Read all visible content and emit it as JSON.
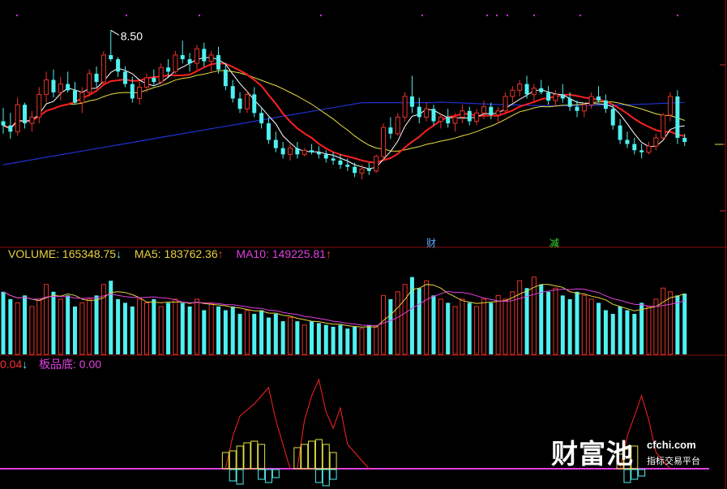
{
  "colors": {
    "background": "#000000",
    "up": "#e8342a",
    "down": "#50f0f0",
    "ma_fast": "#ffffff",
    "ma_red": "#ff2020",
    "ma_yellow": "#e8e040",
    "ma_blue": "#2030d0",
    "vol_label": "#e8d040",
    "ma5_label": "#e8d040",
    "ma10_label": "#e040e0",
    "grid": "#8a1010",
    "event_cai": "#5ab0ff",
    "event_jian": "#30e030"
  },
  "price_panel": {
    "high_label": "8.50"
  },
  "volume_panel": {
    "label_volume": "VOLUME: 165348.75",
    "arrow_volume": "↓",
    "label_ma5": "MA5: 183762.36",
    "arrow_ma5": "↑",
    "label_ma10": "MA10: 149225.81",
    "arrow_ma10": "↑"
  },
  "indicator_panel": {
    "value_label": "0.04",
    "arrow": "↓",
    "name_label": "板品底: 0.00"
  },
  "events": {
    "cai": "财",
    "jian": "减"
  },
  "watermark": {
    "chinese": "财富池",
    "domain": "cfchi.com",
    "subtitle": "指标交易平台"
  },
  "chart_data": {
    "type": "candlestick",
    "title": "",
    "ohlc": [
      [
        7.62,
        7.75,
        7.5,
        7.58
      ],
      [
        7.58,
        7.7,
        7.45,
        7.52
      ],
      [
        7.52,
        7.85,
        7.48,
        7.78
      ],
      [
        7.78,
        7.8,
        7.55,
        7.6
      ],
      [
        7.6,
        7.72,
        7.52,
        7.66
      ],
      [
        7.66,
        7.95,
        7.6,
        7.88
      ],
      [
        7.88,
        8.1,
        7.8,
        8.02
      ],
      [
        8.02,
        8.12,
        7.85,
        7.9
      ],
      [
        7.9,
        8.05,
        7.82,
        7.98
      ],
      [
        7.98,
        8.1,
        7.9,
        7.92
      ],
      [
        7.92,
        8.0,
        7.78,
        7.8
      ],
      [
        7.8,
        7.95,
        7.7,
        7.9
      ],
      [
        7.9,
        8.12,
        7.86,
        8.08
      ],
      [
        8.08,
        8.15,
        7.95,
        8.0
      ],
      [
        8.0,
        8.3,
        7.98,
        8.26
      ],
      [
        8.26,
        8.5,
        8.2,
        8.22
      ],
      [
        8.22,
        8.24,
        8.05,
        8.1
      ],
      [
        8.1,
        8.15,
        7.95,
        7.98
      ],
      [
        7.98,
        8.05,
        7.8,
        7.84
      ],
      [
        7.84,
        8.0,
        7.78,
        7.95
      ],
      [
        7.95,
        8.08,
        7.9,
        8.04
      ],
      [
        8.04,
        8.12,
        7.96,
        8.0
      ],
      [
        8.0,
        8.18,
        7.98,
        8.14
      ],
      [
        8.14,
        8.22,
        8.05,
        8.1
      ],
      [
        8.1,
        8.3,
        8.08,
        8.26
      ],
      [
        8.26,
        8.4,
        8.18,
        8.22
      ],
      [
        8.22,
        8.28,
        8.1,
        8.18
      ],
      [
        8.18,
        8.36,
        8.12,
        8.32
      ],
      [
        8.32,
        8.38,
        8.15,
        8.2
      ],
      [
        8.2,
        8.3,
        8.1,
        8.26
      ],
      [
        8.26,
        8.34,
        8.08,
        8.12
      ],
      [
        8.12,
        8.18,
        7.92,
        7.96
      ],
      [
        7.96,
        8.02,
        7.8,
        7.84
      ],
      [
        7.84,
        7.9,
        7.7,
        7.74
      ],
      [
        7.74,
        7.92,
        7.7,
        7.88
      ],
      [
        7.88,
        7.95,
        7.66,
        7.7
      ],
      [
        7.7,
        7.76,
        7.55,
        7.6
      ],
      [
        7.6,
        7.66,
        7.4,
        7.44
      ],
      [
        7.44,
        7.52,
        7.32,
        7.36
      ],
      [
        7.36,
        7.42,
        7.26,
        7.3
      ],
      [
        7.3,
        7.4,
        7.24,
        7.36
      ],
      [
        7.36,
        7.42,
        7.26,
        7.3
      ],
      [
        7.3,
        7.36,
        7.28,
        7.34
      ],
      [
        7.34,
        7.4,
        7.3,
        7.32
      ],
      [
        7.32,
        7.38,
        7.26,
        7.3
      ],
      [
        7.3,
        7.34,
        7.22,
        7.26
      ],
      [
        7.26,
        7.32,
        7.2,
        7.24
      ],
      [
        7.24,
        7.3,
        7.16,
        7.2
      ],
      [
        7.2,
        7.26,
        7.14,
        7.18
      ],
      [
        7.18,
        7.22,
        7.08,
        7.12
      ],
      [
        7.12,
        7.2,
        7.06,
        7.16
      ],
      [
        7.16,
        7.22,
        7.1,
        7.14
      ],
      [
        7.14,
        7.3,
        7.12,
        7.28
      ],
      [
        7.28,
        7.6,
        7.24,
        7.56
      ],
      [
        7.56,
        7.66,
        7.45,
        7.5
      ],
      [
        7.5,
        7.7,
        7.48,
        7.66
      ],
      [
        7.66,
        7.9,
        7.62,
        7.86
      ],
      [
        7.86,
        8.06,
        7.7,
        7.76
      ],
      [
        7.76,
        7.85,
        7.6,
        7.66
      ],
      [
        7.66,
        7.8,
        7.62,
        7.74
      ],
      [
        7.74,
        7.78,
        7.58,
        7.62
      ],
      [
        7.62,
        7.7,
        7.55,
        7.66
      ],
      [
        7.66,
        7.74,
        7.56,
        7.6
      ],
      [
        7.6,
        7.7,
        7.52,
        7.66
      ],
      [
        7.66,
        7.78,
        7.6,
        7.72
      ],
      [
        7.72,
        7.76,
        7.58,
        7.62
      ],
      [
        7.62,
        7.74,
        7.58,
        7.7
      ],
      [
        7.7,
        7.82,
        7.64,
        7.76
      ],
      [
        7.76,
        7.8,
        7.64,
        7.68
      ],
      [
        7.68,
        7.76,
        7.6,
        7.72
      ],
      [
        7.72,
        7.9,
        7.7,
        7.86
      ],
      [
        7.86,
        7.96,
        7.8,
        7.92
      ],
      [
        7.92,
        8.02,
        7.86,
        7.98
      ],
      [
        7.98,
        8.06,
        7.84,
        7.88
      ],
      [
        7.88,
        7.98,
        7.8,
        7.94
      ],
      [
        7.94,
        8.02,
        7.88,
        7.9
      ],
      [
        7.9,
        7.96,
        7.78,
        7.82
      ],
      [
        7.82,
        7.92,
        7.76,
        7.88
      ],
      [
        7.88,
        7.98,
        7.8,
        7.84
      ],
      [
        7.84,
        7.9,
        7.72,
        7.76
      ],
      [
        7.76,
        7.82,
        7.66,
        7.72
      ],
      [
        7.72,
        7.8,
        7.66,
        7.78
      ],
      [
        7.78,
        7.9,
        7.74,
        7.86
      ],
      [
        7.86,
        7.96,
        7.8,
        7.82
      ],
      [
        7.82,
        7.88,
        7.7,
        7.74
      ],
      [
        7.74,
        7.78,
        7.54,
        7.58
      ],
      [
        7.58,
        7.64,
        7.4,
        7.44
      ],
      [
        7.44,
        7.52,
        7.36,
        7.4
      ],
      [
        7.4,
        7.46,
        7.3,
        7.34
      ],
      [
        7.34,
        7.4,
        7.26,
        7.32
      ],
      [
        7.32,
        7.42,
        7.3,
        7.38
      ],
      [
        7.38,
        7.5,
        7.34,
        7.46
      ],
      [
        7.46,
        7.7,
        7.44,
        7.68
      ],
      [
        7.68,
        7.9,
        7.62,
        7.86
      ],
      [
        7.86,
        7.92,
        7.4,
        7.46
      ],
      [
        7.46,
        7.5,
        7.38,
        7.42
      ]
    ],
    "volume": [
      170,
      150,
      140,
      160,
      130,
      150,
      190,
      170,
      150,
      160,
      130,
      140,
      150,
      160,
      190,
      200,
      150,
      140,
      130,
      150,
      140,
      150,
      130,
      140,
      150,
      140,
      130,
      150,
      120,
      140,
      130,
      120,
      130,
      110,
      120,
      110,
      120,
      100,
      110,
      90,
      100,
      90,
      80,
      90,
      85,
      80,
      75,
      80,
      70,
      75,
      70,
      80,
      75,
      160,
      150,
      170,
      190,
      210,
      180,
      200,
      160,
      150,
      140,
      130,
      150,
      140,
      130,
      150,
      140,
      160,
      150,
      170,
      200,
      180,
      210,
      190,
      170,
      180,
      160,
      150,
      170,
      160,
      150,
      140,
      120,
      110,
      130,
      120,
      110,
      140,
      130,
      150,
      180,
      170,
      160,
      165
    ],
    "indicator": [
      0,
      0,
      0,
      0,
      0,
      0,
      0,
      0,
      0,
      0,
      0,
      0,
      0,
      0,
      0,
      0,
      0,
      0,
      0,
      0,
      0,
      0,
      0,
      0,
      0,
      0,
      0,
      0,
      0,
      0,
      0,
      0,
      0,
      0,
      0,
      0,
      0,
      0,
      0,
      0,
      0,
      0,
      0,
      0,
      0,
      0,
      0,
      0,
      0,
      0,
      0,
      0,
      0,
      0,
      0,
      0,
      0,
      0,
      0,
      0,
      0,
      0,
      0,
      0,
      0,
      0,
      0,
      0,
      0,
      0,
      0,
      0,
      0,
      0,
      0,
      0,
      0,
      0,
      0,
      0,
      0,
      0,
      0,
      0,
      0,
      0,
      0,
      0,
      0,
      0,
      0,
      0,
      0,
      0,
      0,
      0.04
    ],
    "xlabel": "",
    "ylabel": "",
    "grid": true
  }
}
